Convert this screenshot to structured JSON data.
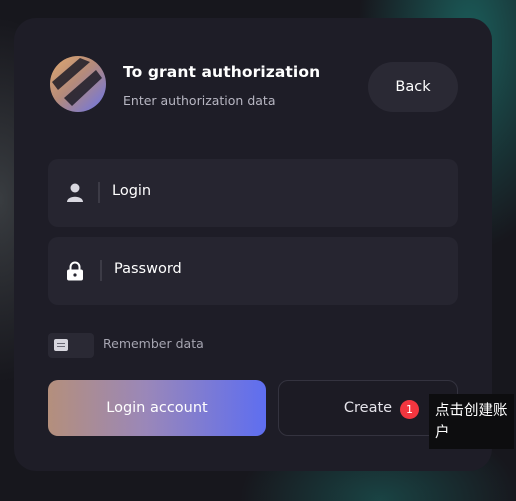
{
  "header": {
    "title": "To grant authorization",
    "subtitle": "Enter authorization data",
    "back_label": "Back"
  },
  "fields": {
    "login_label": "Login",
    "password_label": "Password"
  },
  "remember": {
    "label": "Remember data"
  },
  "actions": {
    "login_label": "Login account",
    "create_label": "Create"
  },
  "annotation": {
    "badge": "1",
    "tooltip": "点击创建账户"
  },
  "colors": {
    "card_bg": "#1e1d27",
    "field_bg": "#262530",
    "accent_start": "#b48f7c",
    "accent_end": "#5e6ef0",
    "badge": "#f2363f"
  },
  "icons": {
    "logo": "striped-globe-logo",
    "login": "user-icon",
    "password": "lock-icon",
    "remember": "toggle-icon"
  }
}
